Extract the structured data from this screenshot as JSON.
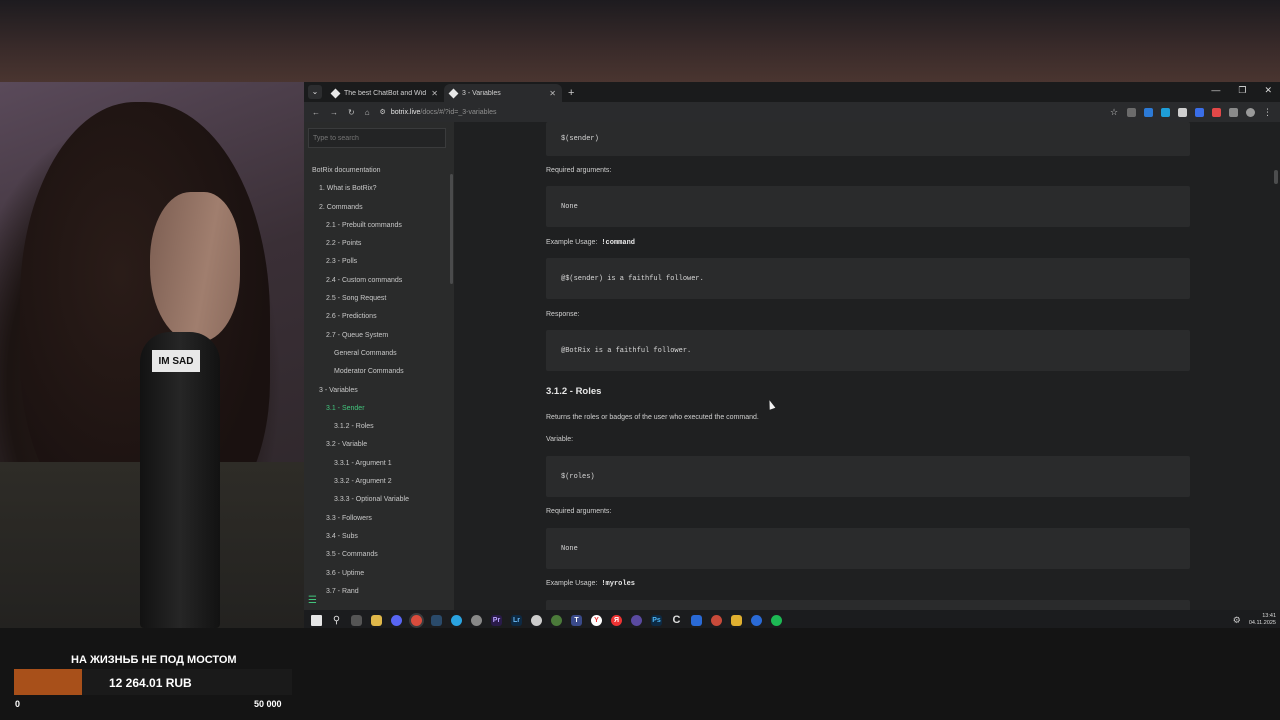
{
  "browser": {
    "tabs": [
      {
        "title": "The best ChatBot and Widgets"
      },
      {
        "title": "3 - Variables"
      }
    ],
    "url": {
      "host": "botrix.live",
      "path": "/docs/#/?id=_3-variables"
    }
  },
  "sidebar": {
    "search_placeholder": "Type to search",
    "items": [
      {
        "label": "BotRix documentation",
        "level": 0
      },
      {
        "label": "1. What is BotRix?",
        "level": 1
      },
      {
        "label": "2. Commands",
        "level": 1
      },
      {
        "label": "2.1 - Prebuilt commands",
        "level": 2
      },
      {
        "label": "2.2 - Points",
        "level": 2
      },
      {
        "label": "2.3 - Polls",
        "level": 2
      },
      {
        "label": "2.4 - Custom commands",
        "level": 2
      },
      {
        "label": "2.5 - Song Request",
        "level": 2
      },
      {
        "label": "2.6 - Predictions",
        "level": 2
      },
      {
        "label": "2.7 - Queue System",
        "level": 2
      },
      {
        "label": "General Commands",
        "level": 3
      },
      {
        "label": "Moderator Commands",
        "level": 3
      },
      {
        "label": "3 - Variables",
        "level": 1
      },
      {
        "label": "3.1 - Sender",
        "level": 2,
        "active": true
      },
      {
        "label": "3.1.2 - Roles",
        "level": 3
      },
      {
        "label": "3.2 - Variable",
        "level": 2
      },
      {
        "label": "3.3.1 - Argument 1",
        "level": 3
      },
      {
        "label": "3.3.2 - Argument 2",
        "level": 3
      },
      {
        "label": "3.3.3 - Optional Variable",
        "level": 3
      },
      {
        "label": "3.3 - Followers",
        "level": 2
      },
      {
        "label": "3.4 - Subs",
        "level": 2
      },
      {
        "label": "3.5 - Commands",
        "level": 2
      },
      {
        "label": "3.6 - Uptime",
        "level": 2
      },
      {
        "label": "3.7 - Rand",
        "level": 2
      }
    ]
  },
  "doc": {
    "sender_code": "$(sender)",
    "required_label": "Required arguments:",
    "none_value": "None",
    "example_label": "Example Usage:",
    "example_command_1": "!command",
    "example_code_1": "@$(sender) is a faithful follower.",
    "response_label": "Response:",
    "response_code": "@BotRix is a faithful follower.",
    "roles_heading": "3.1.2 - Roles",
    "roles_description": "Returns the roles or badges of the user who executed the command.",
    "variable_label": "Variable:",
    "roles_code": "$(roles)",
    "example_command_2": "!myroles"
  },
  "taskbar": {
    "time": "13:41",
    "date": "04.11.2025"
  },
  "webcam": {
    "mic_sticker": "IM SAD"
  },
  "donation_goal": {
    "title": "НА ЖИЗНЬБ НЕ ПОД МОСТОМ",
    "amount": "12 264.01 RUB",
    "min": "0",
    "max": "50 000",
    "bar_color": "#a8501a"
  }
}
